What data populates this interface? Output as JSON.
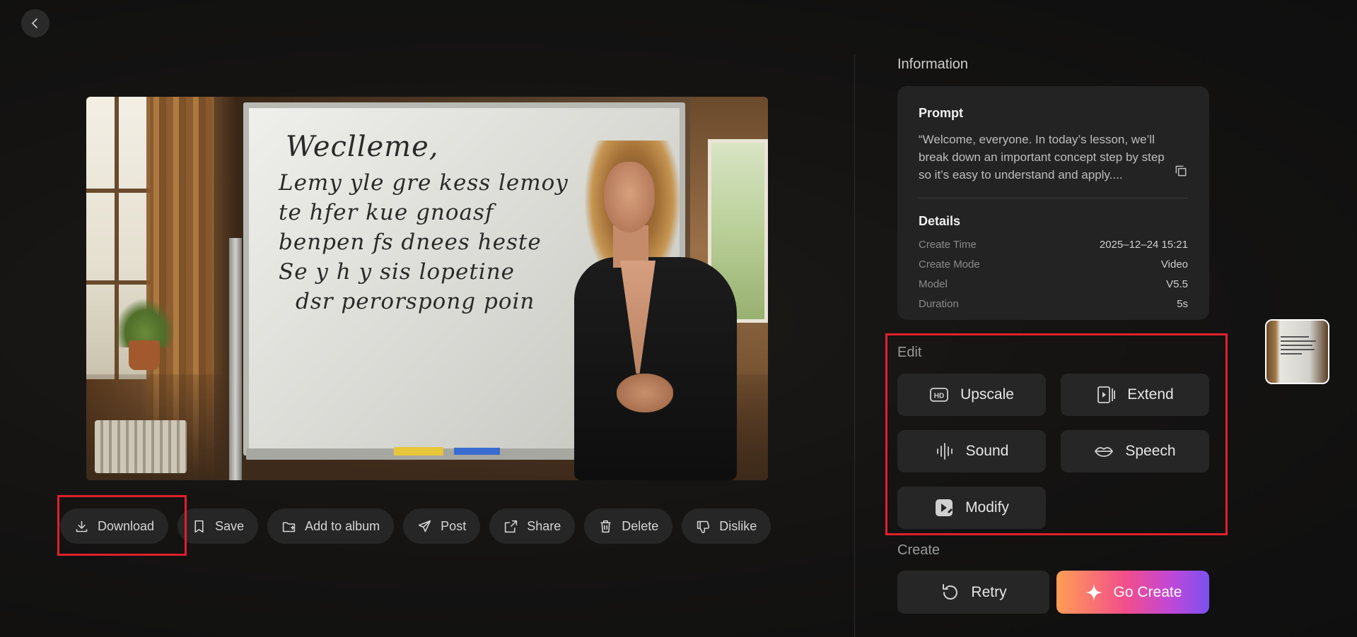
{
  "nav": {
    "back_icon": "chevron-left-icon"
  },
  "video": {
    "whiteboard_lines": [
      "Weclleme,",
      "Lemy yle gre kess lemoy",
      "te hfer kue gnoasf",
      "benpen fs dnees heste",
      "Se y h y sis lopetine",
      "dsr perorspong poin"
    ]
  },
  "actions": [
    {
      "id": "download",
      "label": "Download",
      "icon": "download-icon"
    },
    {
      "id": "save",
      "label": "Save",
      "icon": "bookmark-icon"
    },
    {
      "id": "add-to-album",
      "label": "Add to album",
      "icon": "folder-add-icon"
    },
    {
      "id": "post",
      "label": "Post",
      "icon": "send-icon"
    },
    {
      "id": "share",
      "label": "Share",
      "icon": "share-icon"
    },
    {
      "id": "delete",
      "label": "Delete",
      "icon": "trash-icon"
    },
    {
      "id": "dislike",
      "label": "Dislike",
      "icon": "thumbs-down-icon"
    }
  ],
  "information": {
    "title": "Information",
    "prompt_heading": "Prompt",
    "prompt_text": "“Welcome, everyone. In today’s lesson, we’ll break down an important concept step by step so it’s easy to understand and apply....",
    "details_heading": "Details",
    "details": [
      {
        "key": "Create Time",
        "value": "2025–12–24 15:21"
      },
      {
        "key": "Create Mode",
        "value": "Video"
      },
      {
        "key": "Model",
        "value": "V5.5"
      },
      {
        "key": "Duration",
        "value": "5s"
      }
    ]
  },
  "edit": {
    "title": "Edit",
    "buttons": [
      {
        "id": "upscale",
        "label": "Upscale",
        "icon": "hd-icon"
      },
      {
        "id": "extend",
        "label": "Extend",
        "icon": "video-extend-icon"
      },
      {
        "id": "sound",
        "label": "Sound",
        "icon": "sound-wave-icon"
      },
      {
        "id": "speech",
        "label": "Speech",
        "icon": "lips-icon"
      },
      {
        "id": "modify",
        "label": "Modify",
        "icon": "modify-video-icon"
      }
    ]
  },
  "create": {
    "title": "Create",
    "retry_label": "Retry",
    "go_label": "Go Create"
  },
  "colors": {
    "accent_gradient": [
      "#ff9e55",
      "#f24e8a",
      "#c048d8",
      "#7b52ef"
    ],
    "highlight": "#e0202a",
    "background": "#141312"
  }
}
